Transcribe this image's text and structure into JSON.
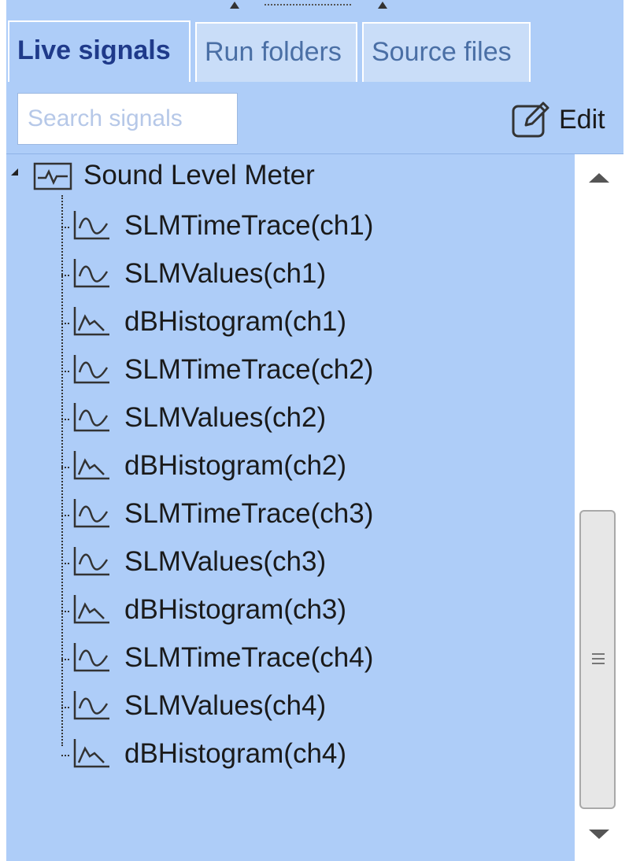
{
  "tabs": [
    {
      "label": "Live signals",
      "active": true
    },
    {
      "label": "Run folders",
      "active": false
    },
    {
      "label": "Source files",
      "active": false
    }
  ],
  "toolbar": {
    "search_placeholder": "Search signals",
    "edit_label": "Edit",
    "edit_icon": "pencil-edit-icon"
  },
  "tree": {
    "root": {
      "label": "Sound Level Meter",
      "icon": "signal-group-icon",
      "expanded": true
    },
    "items": [
      {
        "label": "SLMTimeTrace(ch1)",
        "icon": "wave-icon"
      },
      {
        "label": "SLMValues(ch1)",
        "icon": "wave-icon"
      },
      {
        "label": "dBHistogram(ch1)",
        "icon": "histogram-icon"
      },
      {
        "label": "SLMTimeTrace(ch2)",
        "icon": "wave-icon"
      },
      {
        "label": "SLMValues(ch2)",
        "icon": "wave-icon"
      },
      {
        "label": "dBHistogram(ch2)",
        "icon": "histogram-icon"
      },
      {
        "label": "SLMTimeTrace(ch3)",
        "icon": "wave-icon"
      },
      {
        "label": "SLMValues(ch3)",
        "icon": "wave-icon"
      },
      {
        "label": "dBHistogram(ch3)",
        "icon": "histogram-icon"
      },
      {
        "label": "SLMTimeTrace(ch4)",
        "icon": "wave-icon"
      },
      {
        "label": "SLMValues(ch4)",
        "icon": "wave-icon"
      },
      {
        "label": "dBHistogram(ch4)",
        "icon": "histogram-icon"
      }
    ]
  },
  "colors": {
    "panel_bg": "#aecdf8",
    "active_tab_text": "#1f3a8a",
    "inactive_tab_text": "#4a6fa5"
  }
}
